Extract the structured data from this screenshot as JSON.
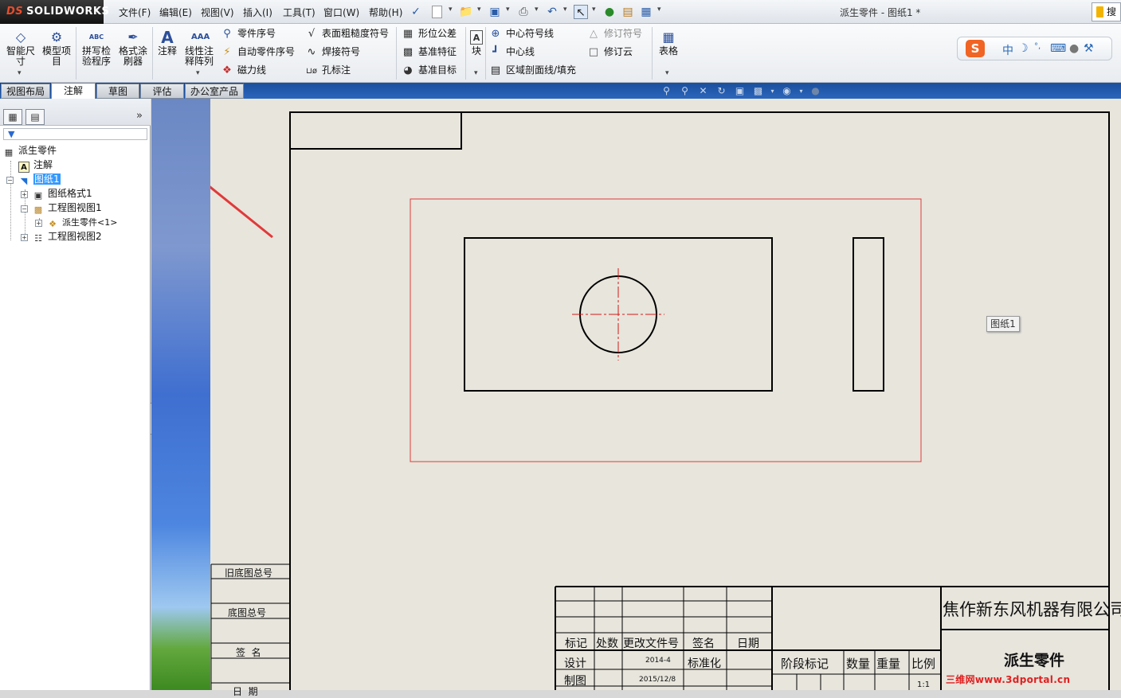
{
  "app": {
    "brand": "SOLIDWORKS",
    "brand_mark": "DS",
    "document_title": "派生零件 - 图纸1 *",
    "search_tab": "搜"
  },
  "menu": {
    "items": [
      "文件(F)",
      "编辑(E)",
      "视图(V)",
      "插入(I)",
      "工具(T)",
      "窗口(W)",
      "帮助(H)"
    ]
  },
  "command_manager": {
    "big_buttons": [
      {
        "label": "智能尺寸",
        "icon": "smart-dimension-icon"
      },
      {
        "label": "模型项目",
        "icon": "model-items-icon"
      },
      {
        "label": "拼写检验程序",
        "icon": "spell-check-icon",
        "badge": "ABC"
      },
      {
        "label": "格式涂刷器",
        "icon": "format-painter-icon"
      },
      {
        "label": "注释",
        "icon": "note-icon"
      },
      {
        "label": "线性注释阵列",
        "icon": "linear-note-pattern-icon"
      },
      {
        "label": "块",
        "icon": "block-icon"
      },
      {
        "label": "表格",
        "icon": "table-icon"
      }
    ],
    "group1": [
      {
        "label": "零件序号",
        "icon": "balloon-icon"
      },
      {
        "label": "自动零件序号",
        "icon": "auto-balloon-icon"
      },
      {
        "label": "磁力线",
        "icon": "magnetic-line-icon"
      }
    ],
    "group2": [
      {
        "label": "表面粗糙度符号",
        "icon": "surface-finish-icon"
      },
      {
        "label": "焊接符号",
        "icon": "weld-symbol-icon"
      },
      {
        "label": "孔标注",
        "icon": "hole-callout-icon"
      }
    ],
    "group3": [
      {
        "label": "形位公差",
        "icon": "geometric-tolerance-icon"
      },
      {
        "label": "基准特征",
        "icon": "datum-feature-icon"
      },
      {
        "label": "基准目标",
        "icon": "datum-target-icon"
      }
    ],
    "group4": [
      {
        "label": "中心符号线",
        "icon": "center-mark-icon"
      },
      {
        "label": "中心线",
        "icon": "centerline-icon"
      },
      {
        "label": "区域剖面线/填充",
        "icon": "area-hatch-icon"
      }
    ],
    "group5": [
      {
        "label": "修订符号",
        "icon": "revision-symbol-icon",
        "disabled": true
      },
      {
        "label": "修订云",
        "icon": "revision-cloud-icon",
        "disabled": false
      }
    ]
  },
  "ime": {
    "mode": "中",
    "logo": "S"
  },
  "tabs": [
    "视图布局",
    "注解",
    "草图",
    "评估",
    "办公室产品"
  ],
  "active_tab": "注解",
  "feature_tree": {
    "filter_icon": "filter-icon",
    "items": [
      {
        "label": "派生零件",
        "icon": "drawing-icon",
        "level": 0
      },
      {
        "label": "注解",
        "icon": "annotations-icon",
        "level": 1
      },
      {
        "label": "图纸1",
        "icon": "sheet-icon",
        "level": 1,
        "selected": true,
        "expand": "−"
      },
      {
        "label": "图纸格式1",
        "icon": "sheet-format-icon",
        "level": 2,
        "expand": "+"
      },
      {
        "label": "工程图视图1",
        "icon": "drawing-view-icon",
        "level": 2,
        "expand": "−"
      },
      {
        "label": "派生零件<1>",
        "icon": "part-icon",
        "level": 3,
        "expand": "+"
      },
      {
        "label": "工程图视图2",
        "icon": "drawing-view-icon",
        "level": 2,
        "expand": "+"
      }
    ]
  },
  "sheet": {
    "name_tag": "图纸1"
  },
  "title_block": {
    "side_labels": [
      "旧底图总号",
      "底图总号",
      "签  名",
      "日  期"
    ],
    "rev_headers": [
      "标记",
      "处数",
      "更改文件号",
      "签名",
      "日期"
    ],
    "sign_rows": [
      {
        "role": "设计",
        "date": "2014-4",
        "approval": "标准化"
      },
      {
        "role": "制图",
        "date": "2015/12/8",
        "approval": ""
      }
    ],
    "company": "焦作新东风机器有限公司",
    "part_name": "派生零件",
    "stage_headers": [
      "阶段标记",
      "数量",
      "重量",
      "比例"
    ],
    "scale": "1:1"
  },
  "watermark": "三维网www.3dportal.cn",
  "colors": {
    "annotation_arrow": "#e03a3a",
    "view_boundary": "#e03a3a",
    "centerline": "#d21a1a",
    "sheet_background": "#e7e5dc",
    "selection": "#3399ff"
  }
}
